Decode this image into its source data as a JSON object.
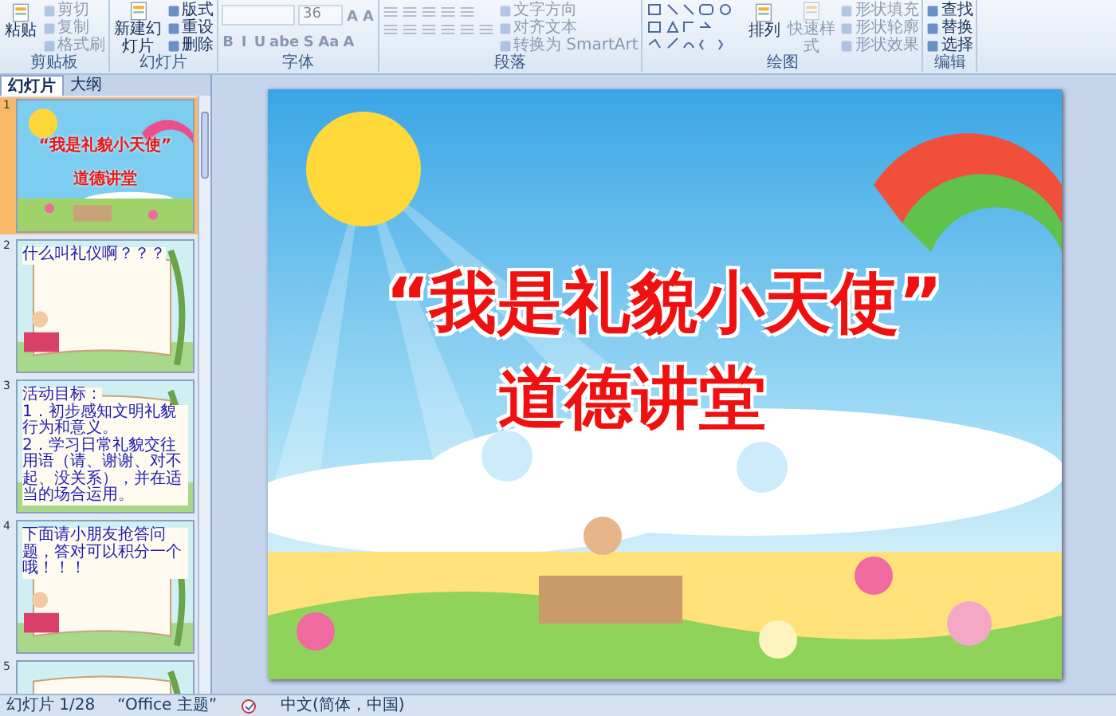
{
  "ribbon": {
    "groups": [
      {
        "label": "剪贴板",
        "columns": [
          [
            [
              {
                "kind": "big",
                "label": "粘贴",
                "disabled": false
              }
            ]
          ],
          [
            [
              {
                "kind": "small",
                "label": "剪切",
                "disabled": true
              }
            ],
            [
              {
                "kind": "small",
                "label": "复制",
                "disabled": true
              }
            ],
            [
              {
                "kind": "small",
                "label": "格式刷",
                "disabled": true
              }
            ]
          ]
        ]
      },
      {
        "label": "幻灯片",
        "columns": [
          [
            [
              {
                "kind": "big",
                "label": "新建幻灯片",
                "disabled": false
              }
            ]
          ],
          [
            [
              {
                "kind": "small",
                "label": "版式",
                "disabled": false
              }
            ],
            [
              {
                "kind": "small",
                "label": "重设",
                "disabled": false
              }
            ],
            [
              {
                "kind": "small",
                "label": "删除",
                "disabled": false
              }
            ]
          ]
        ]
      },
      {
        "label": "字体",
        "columns": [
          [
            [
              {
                "kind": "blank-field",
                "disabled": true
              },
              {
                "kind": "field",
                "label": "36",
                "disabled": true
              },
              {
                "kind": "glyph",
                "label": "A",
                "disabled": true
              },
              {
                "kind": "glyph",
                "label": "A",
                "disabled": true
              }
            ],
            [
              {
                "kind": "glyph",
                "label": "B",
                "disabled": true
              },
              {
                "kind": "glyph",
                "label": "I",
                "disabled": true
              },
              {
                "kind": "glyph",
                "label": "U",
                "disabled": true
              },
              {
                "kind": "glyph",
                "label": "abe",
                "disabled": true
              },
              {
                "kind": "glyph",
                "label": "S",
                "disabled": true
              },
              {
                "kind": "glyph",
                "label": "Aa",
                "disabled": true
              },
              {
                "kind": "glyph",
                "label": "A",
                "disabled": true
              }
            ]
          ]
        ]
      },
      {
        "label": "段落",
        "columns": [
          [
            [
              {
                "kind": "icon",
                "disabled": true
              },
              {
                "kind": "icon",
                "disabled": true
              },
              {
                "kind": "icon",
                "disabled": true
              },
              {
                "kind": "icon",
                "disabled": true
              },
              {
                "kind": "icon",
                "disabled": true
              }
            ],
            [
              {
                "kind": "icon",
                "disabled": true
              },
              {
                "kind": "icon",
                "disabled": true
              },
              {
                "kind": "icon",
                "disabled": true
              },
              {
                "kind": "icon",
                "disabled": true
              },
              {
                "kind": "icon",
                "disabled": true
              },
              {
                "kind": "icon",
                "disabled": true
              }
            ]
          ],
          [
            [
              {
                "kind": "small",
                "label": "文字方向",
                "disabled": true
              }
            ],
            [
              {
                "kind": "small",
                "label": "对齐文本",
                "disabled": true
              }
            ],
            [
              {
                "kind": "small",
                "label": "转换为 SmartArt",
                "disabled": true
              }
            ]
          ]
        ]
      },
      {
        "label": "绘图",
        "columns": [
          [
            [
              {
                "kind": "shapes",
                "disabled": false
              }
            ]
          ],
          [
            [
              {
                "kind": "big",
                "label": "排列",
                "disabled": false
              }
            ]
          ],
          [
            [
              {
                "kind": "big",
                "label": "快速样式",
                "disabled": true
              }
            ]
          ],
          [
            [
              {
                "kind": "small",
                "label": "形状填充",
                "disabled": true
              }
            ],
            [
              {
                "kind": "small",
                "label": "形状轮廓",
                "disabled": true
              }
            ],
            [
              {
                "kind": "small",
                "label": "形状效果",
                "disabled": true
              }
            ]
          ]
        ]
      },
      {
        "label": "编辑",
        "columns": [
          [
            [
              {
                "kind": "small",
                "label": "查找",
                "disabled": false
              }
            ],
            [
              {
                "kind": "small",
                "label": "替换",
                "disabled": false
              }
            ],
            [
              {
                "kind": "small",
                "label": "选择",
                "disabled": false
              }
            ]
          ]
        ]
      }
    ]
  },
  "panel": {
    "tabs": [
      {
        "label": "幻灯片",
        "selected": true
      },
      {
        "label": "大纲",
        "selected": false
      }
    ],
    "thumbnails": [
      {
        "number": "1",
        "selected": true,
        "kind": "title",
        "lines": [
          "“我是礼貌小天使”",
          "道德讲堂"
        ]
      },
      {
        "number": "2",
        "selected": false,
        "kind": "book",
        "lines": [
          "什么叫礼仪啊？？？"
        ]
      },
      {
        "number": "3",
        "selected": false,
        "kind": "book",
        "lines": [
          "活动目标：",
          "1．初步感知文明礼貌行为和意义。",
          "2．学习日常礼貌交往用语（请、谢谢、对不起、没关系），并在适当的场合运用。"
        ]
      },
      {
        "number": "4",
        "selected": false,
        "kind": "book",
        "lines": [
          "下面请小朋友抢答问题，答对可以积分一个哦！！！"
        ]
      },
      {
        "number": "5",
        "selected": false,
        "kind": "book"
      }
    ]
  },
  "slide": {
    "title_lines": [
      "“我是礼貌小天使”",
      "道德讲堂"
    ]
  },
  "status_bar": {
    "slide": "幻灯片 1/28",
    "theme": "“Office 主题”",
    "language": "中文(简体，中国)"
  }
}
